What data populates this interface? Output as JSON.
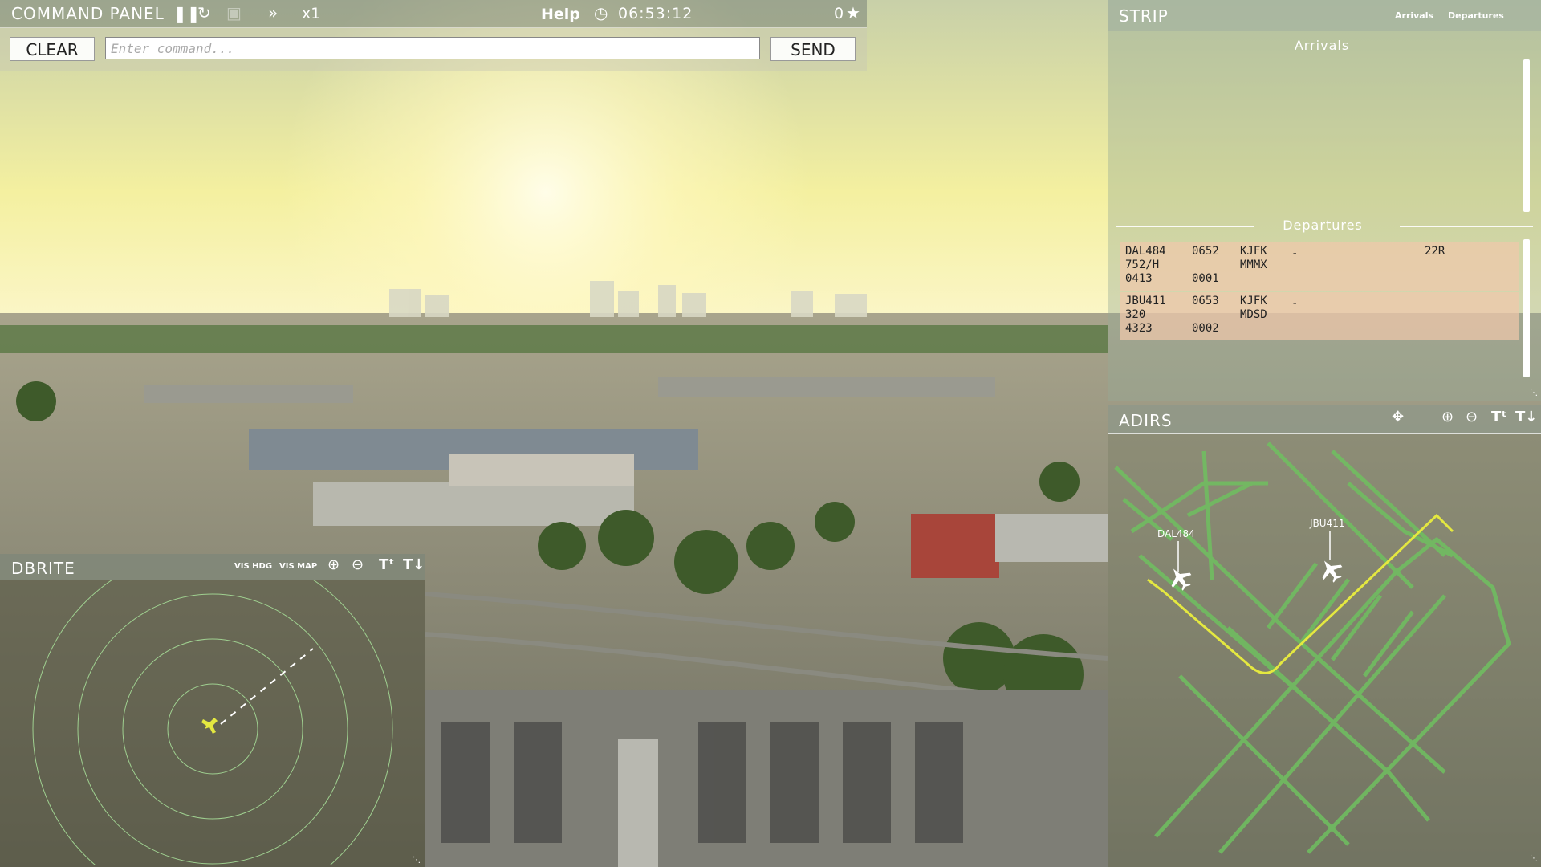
{
  "command_panel": {
    "title": "COMMAND PANEL",
    "speed": "x1",
    "help": "Help",
    "clock": "06:53:12",
    "score": "0",
    "clear_label": "CLEAR",
    "send_label": "SEND",
    "placeholder": "Enter command..."
  },
  "strip": {
    "title": "STRIP",
    "tab_arrivals": "Arrivals",
    "tab_departures": "Departures",
    "arrivals_label": "Arrivals",
    "departures_label": "Departures",
    "departures": [
      {
        "callsign": "DAL484",
        "type": "752/H",
        "squawk": "0413",
        "time": "0652",
        "seq": "0001",
        "origin": "KJFK",
        "dest": "MMMX",
        "status": "-",
        "runway": "22R"
      },
      {
        "callsign": "JBU411",
        "type": "320",
        "squawk": "4323",
        "time": "0653",
        "seq": "0002",
        "origin": "KJFK",
        "dest": "MDSD",
        "status": "-",
        "runway": ""
      }
    ]
  },
  "adirs": {
    "title": "ADIRS",
    "aircraft": [
      {
        "label": "DAL484"
      },
      {
        "label": "JBU411"
      }
    ]
  },
  "dbrite": {
    "title": "DBRITE",
    "vis_hdg": "VIS HDG",
    "vis_map": "VIS MAP"
  },
  "icons": {
    "pause": "pause-icon",
    "restart": "restart-icon",
    "camera": "camera-icon",
    "fast_forward": "fast-forward-icon",
    "clock": "clock-icon",
    "star": "star-icon",
    "move": "move-icon",
    "zoom_in": "zoom-in-icon",
    "zoom_out": "zoom-out-icon",
    "text_up": "text-larger-icon",
    "text_down": "text-smaller-icon"
  },
  "colors": {
    "taxiway": "#6fc060",
    "route": "#e4e840",
    "radar_ring": "#9fd090",
    "strip_row": "#f0c8aa"
  }
}
